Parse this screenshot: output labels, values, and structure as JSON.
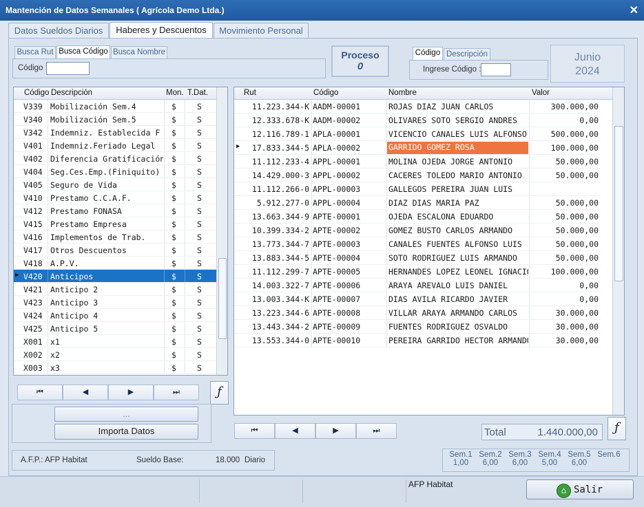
{
  "window": {
    "title": "Mantención de Datos Semanales ( Agrícola Demo Ltda.)",
    "close_label": "✕"
  },
  "tabs": [
    {
      "label": "Datos Sueldos Diarios"
    },
    {
      "label": "Haberes y Descuentos"
    },
    {
      "label": "Movimiento Personal"
    }
  ],
  "search": {
    "tabs": [
      {
        "label": "Busca Rut"
      },
      {
        "label": "Busca Código"
      },
      {
        "label": "Busca Nombre"
      }
    ],
    "field_label": "Código :",
    "value": ""
  },
  "proceso": {
    "title": "Proceso",
    "value": "0"
  },
  "code_search": {
    "tabs": [
      {
        "label": "Código"
      },
      {
        "label": "Descripción"
      }
    ],
    "field_label": "Ingrese Código :",
    "value": ""
  },
  "period": {
    "month": "Junio",
    "year": "2024"
  },
  "concepts": {
    "headers": {
      "code": "Código",
      "desc": "Descripción",
      "mon": "Mon.",
      "tdat": "T.Dat."
    },
    "rows": [
      {
        "code": "V339",
        "desc": "Mobilización Sem.4",
        "mon": "$",
        "tdat": "S"
      },
      {
        "code": "V340",
        "desc": "Mobilización Sem.5",
        "mon": "$",
        "tdat": "S"
      },
      {
        "code": "V342",
        "desc": "Indemniz. Establecida F",
        "mon": "$",
        "tdat": "S"
      },
      {
        "code": "V401",
        "desc": "Indemniz.Feriado Legal",
        "mon": "$",
        "tdat": "S"
      },
      {
        "code": "V402",
        "desc": "Diferencia Gratificación",
        "mon": "$",
        "tdat": "S"
      },
      {
        "code": "V404",
        "desc": "Seg.Ces.Emp.(Finiquito)",
        "mon": "$",
        "tdat": "S"
      },
      {
        "code": "V405",
        "desc": "Seguro de Vida",
        "mon": "$",
        "tdat": "S"
      },
      {
        "code": "V410",
        "desc": "Prestamo C.C.A.F.",
        "mon": "$",
        "tdat": "S"
      },
      {
        "code": "V412",
        "desc": "Prestamo FONASA",
        "mon": "$",
        "tdat": "S"
      },
      {
        "code": "V415",
        "desc": "Prestamo Empresa",
        "mon": "$",
        "tdat": "S"
      },
      {
        "code": "V416",
        "desc": "Implementos de Trab.",
        "mon": "$",
        "tdat": "S"
      },
      {
        "code": "V417",
        "desc": "Otros Descuentos",
        "mon": "$",
        "tdat": "S"
      },
      {
        "code": "V418",
        "desc": "A.P.V.",
        "mon": "$",
        "tdat": "S"
      },
      {
        "code": "V420",
        "desc": "Anticipos",
        "mon": "$",
        "tdat": "S"
      },
      {
        "code": "V421",
        "desc": "Anticipo 2",
        "mon": "$",
        "tdat": "S"
      },
      {
        "code": "V423",
        "desc": "Anticipo 3",
        "mon": "$",
        "tdat": "S"
      },
      {
        "code": "V424",
        "desc": "Anticipo 4",
        "mon": "$",
        "tdat": "S"
      },
      {
        "code": "V425",
        "desc": "Anticipo 5",
        "mon": "$",
        "tdat": "S"
      },
      {
        "code": "X001",
        "desc": "x1",
        "mon": "$",
        "tdat": "S"
      },
      {
        "code": "X002",
        "desc": "x2",
        "mon": "$",
        "tdat": "S"
      },
      {
        "code": "X003",
        "desc": "x3",
        "mon": "$",
        "tdat": "S"
      }
    ],
    "selected_index": 13,
    "selected_marker": "▶"
  },
  "nav": {
    "first": "⏮",
    "prev": "◀",
    "next": "▶",
    "last": "⏭"
  },
  "fx_label": "ƒ",
  "buttons": {
    "ellipsis": "...",
    "import": "Importa Datos"
  },
  "workers": {
    "headers": {
      "rut": "Rut",
      "code": "Código",
      "name": "Nombre",
      "value": "Valor"
    },
    "rows": [
      {
        "rut": "11.223.344-K",
        "code": "AADM-00001",
        "name": "ROJAS DIAZ JUAN CARLOS",
        "value": "300.000,00"
      },
      {
        "rut": "12.333.678-K",
        "code": "AADM-00002",
        "name": "OLIVARES SOTO SERGIO ANDRES",
        "value": "0,00"
      },
      {
        "rut": "12.116.789-1",
        "code": "APLA-00001",
        "name": "VICENCIO CANALES LUIS ALFONSO",
        "value": "500.000,00"
      },
      {
        "rut": "17.833.344-5",
        "code": "APLA-00002",
        "name": "GARRIDO GOMEZ ROSA",
        "value": "100.000,00"
      },
      {
        "rut": "11.112.233-4",
        "code": "APPL-00001",
        "name": "MOLINA OJEDA JORGE ANTONIO",
        "value": "50.000,00"
      },
      {
        "rut": "14.429.000-3",
        "code": "APPL-00002",
        "name": "CACERES TOLEDO MARIO ANTONIO",
        "value": "50.000,00"
      },
      {
        "rut": "11.112.266-0",
        "code": "APPL-00003",
        "name": "GALLEGOS PEREIRA JUAN LUIS",
        "value": ""
      },
      {
        "rut": "5.912.277-0",
        "code": "APPL-00004",
        "name": "DIAZ DIAS MARIA PAZ",
        "value": "50.000,00"
      },
      {
        "rut": "13.663.344-9",
        "code": "APTE-00001",
        "name": "OJEDA ESCALONA EDUARDO",
        "value": "50.000,00"
      },
      {
        "rut": "10.399.334-2",
        "code": "APTE-00002",
        "name": "GOMEZ BUSTO CARLOS ARMANDO",
        "value": "50.000,00"
      },
      {
        "rut": "13.773.344-7",
        "code": "APTE-00003",
        "name": "CANALES FUENTES ALFONSO LUIS",
        "value": "50.000,00"
      },
      {
        "rut": "13.883.344-5",
        "code": "APTE-00004",
        "name": "SOTO RODRIGUEZ LUIS ARMANDO",
        "value": "50.000,00"
      },
      {
        "rut": "11.112.299-7",
        "code": "APTE-00005",
        "name": "HERNANDES LOPEZ LEONEL IGNACIO",
        "value": "100.000,00"
      },
      {
        "rut": "14.003.322-7",
        "code": "APTE-00006",
        "name": "ARAYA AREVALO LUIS DANIEL",
        "value": "0,00"
      },
      {
        "rut": "13.003.344-K",
        "code": "APTE-00007",
        "name": "DIAS AVILA RICARDO JAVIER",
        "value": "0,00"
      },
      {
        "rut": "13.223.344-6",
        "code": "APTE-00008",
        "name": "VILLAR ARAYA ARMANDO CARLOS",
        "value": "30.000,00"
      },
      {
        "rut": "13.443.344-2",
        "code": "APTE-00009",
        "name": "FUENTES RODRIGUEZ OSVALDO",
        "value": "30.000,00"
      },
      {
        "rut": "13.553.344-0",
        "code": "APTE-00010",
        "name": "PEREIRA GARRIDO HECTOR ARMANDO",
        "value": "30.000,00"
      }
    ],
    "selected_index": 3,
    "selected_marker": "▶",
    "highlight_color": "#ee7540"
  },
  "total": {
    "label": "Total",
    "value": "1.440.000,00"
  },
  "info": {
    "afp_label": "A.F.P.: AFP Habitat",
    "sueldo_label": "Sueldo Base:",
    "sueldo_value": "18.000",
    "sueldo_unit": "Diario"
  },
  "weeks": [
    {
      "label": "Sem.1",
      "value": "1,00"
    },
    {
      "label": "Sem.2",
      "value": "6,00"
    },
    {
      "label": "Sem.3",
      "value": "6,00"
    },
    {
      "label": "Sem.4",
      "value": "5,00"
    },
    {
      "label": "Sem.5",
      "value": "6,00"
    },
    {
      "label": "Sem.6",
      "value": ""
    }
  ],
  "status": {
    "afp": "AFP Habitat",
    "exit_label": "Salir"
  }
}
